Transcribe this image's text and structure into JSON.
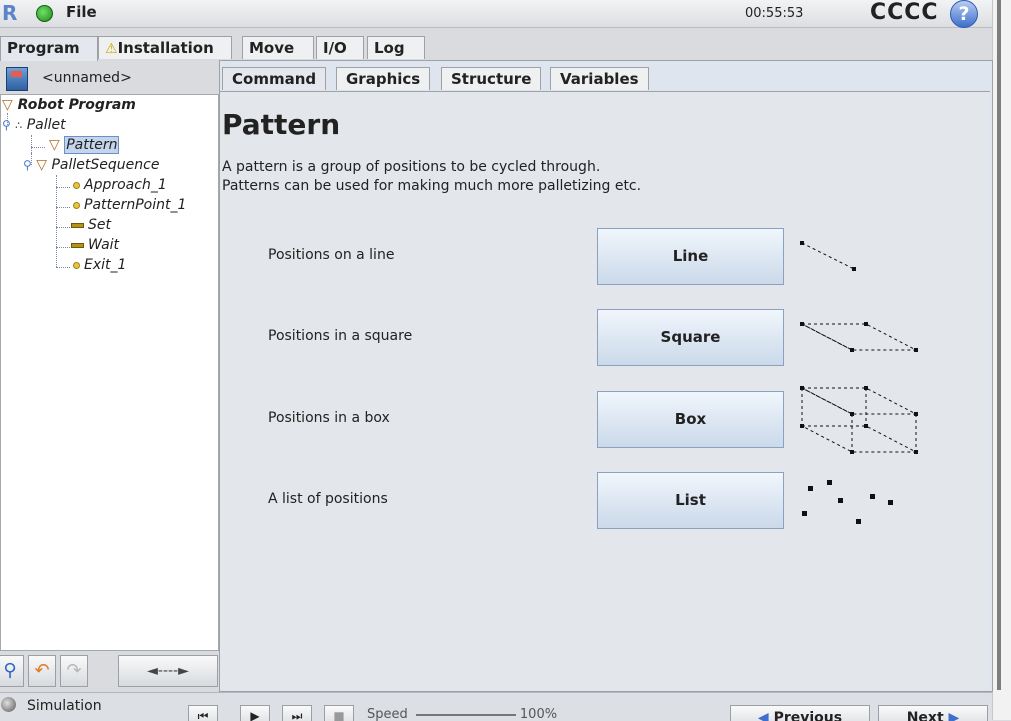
{
  "topbar": {
    "file_menu": "File",
    "clock": "00:55:53",
    "robot_name": "CCCC",
    "help": "?"
  },
  "main_tabs": [
    {
      "label": "Program",
      "active": true
    },
    {
      "label": "Installation",
      "warning": true
    },
    {
      "label": "Move"
    },
    {
      "label": "I/O"
    },
    {
      "label": "Log"
    }
  ],
  "program_file": {
    "name": "<unnamed>"
  },
  "tree": {
    "root": "Robot Program",
    "pallet": "Pallet",
    "pattern": "Pattern",
    "pallet_sequence": "PalletSequence",
    "approach": "Approach_1",
    "pattern_point": "PatternPoint_1",
    "set": "Set",
    "wait": "Wait",
    "exit": "Exit_1"
  },
  "sub_tabs": [
    {
      "label": "Command",
      "active": true
    },
    {
      "label": "Graphics"
    },
    {
      "label": "Structure"
    },
    {
      "label": "Variables"
    }
  ],
  "command": {
    "title": "Pattern",
    "description_line1": "A pattern is a group of positions to be cycled through.",
    "description_line2": "Patterns can be used for making much more palletizing etc.",
    "options": [
      {
        "label": "Positions on a line",
        "button": "Line"
      },
      {
        "label": "Positions in a square",
        "button": "Square"
      },
      {
        "label": "Positions in a box",
        "button": "Box"
      },
      {
        "label": "A list of positions",
        "button": "List"
      }
    ]
  },
  "toolstrip": {
    "search": "⚲",
    "undo": "↶",
    "redo": "↷",
    "arrows": "◄----►"
  },
  "bottombar": {
    "simulation_label": "Simulation",
    "speed_label": "Speed",
    "speed_value": "100%",
    "previous": "Previous",
    "next": "Next"
  },
  "colors": {
    "accent": "#3f6ecb",
    "selection": "#c4d4ec",
    "button": "#cbd9ea"
  }
}
